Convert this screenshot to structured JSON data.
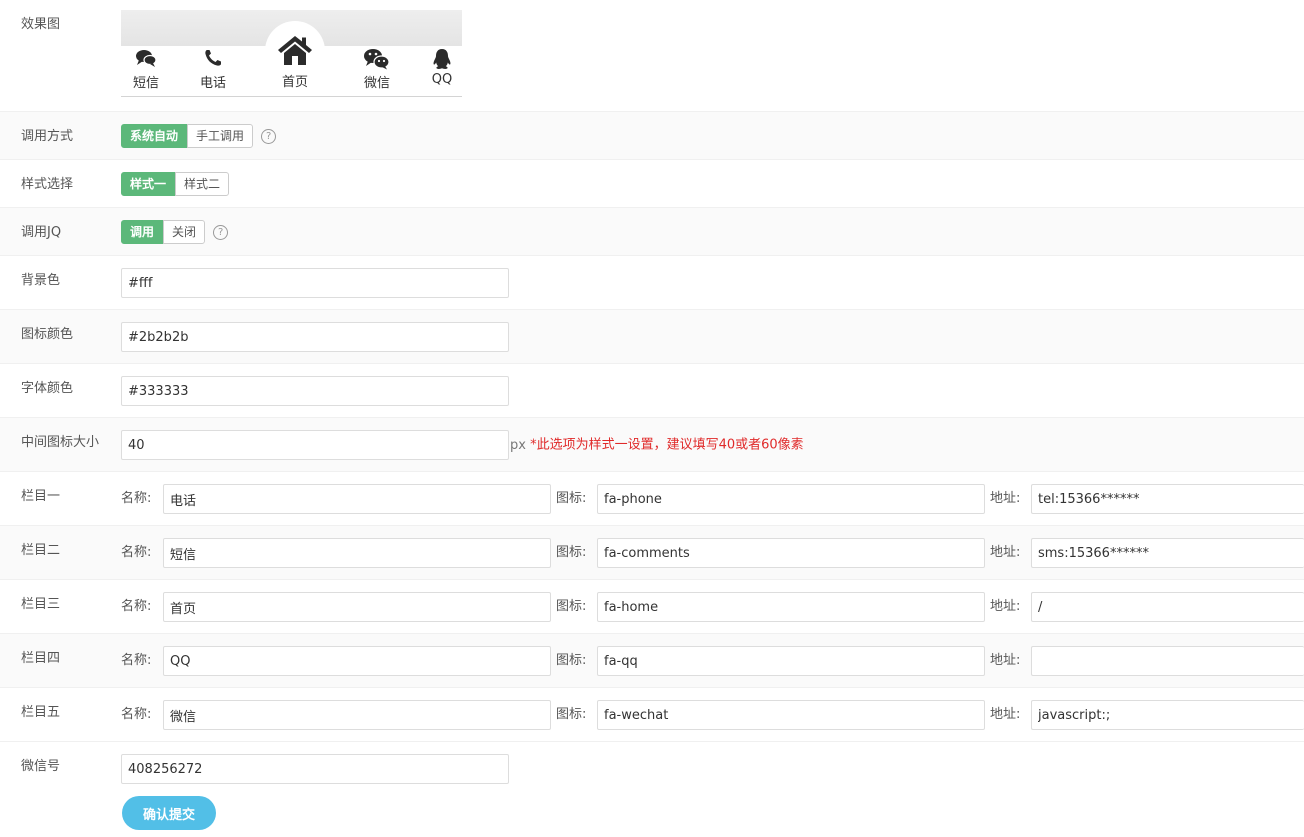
{
  "preview": {
    "label": "效果图",
    "items": [
      {
        "text": "短信",
        "icon": "comments-icon"
      },
      {
        "text": "电话",
        "icon": "phone-icon"
      },
      {
        "text": "首页",
        "icon": "home-icon"
      },
      {
        "text": "微信",
        "icon": "wechat-icon"
      },
      {
        "text": "QQ",
        "icon": "qq-icon"
      }
    ]
  },
  "call_mode": {
    "label": "调用方式",
    "options": [
      "系统自动",
      "手工调用"
    ],
    "selected": "系统自动"
  },
  "style": {
    "label": "样式选择",
    "options": [
      "样式一",
      "样式二"
    ],
    "selected": "样式一"
  },
  "jq": {
    "label": "调用JQ",
    "options": [
      "调用",
      "关闭"
    ],
    "selected": "调用"
  },
  "help_glyph": "?",
  "bg_color": {
    "label": "背景色",
    "value": "#fff"
  },
  "icon_color": {
    "label": "图标颜色",
    "value": "#2b2b2b"
  },
  "font_color": {
    "label": "字体颜色",
    "value": "#333333"
  },
  "center_icon": {
    "label": "中间图标大小",
    "value": "40",
    "unit": "px",
    "note": "*此选项为样式一设置，建议填写40或者60像素"
  },
  "field_labels": {
    "name": "名称:",
    "icon": "图标:",
    "url": "地址:"
  },
  "columns": [
    {
      "label": "栏目一",
      "name": "电话",
      "icon": "fa-phone",
      "url": "tel:15366******"
    },
    {
      "label": "栏目二",
      "name": "短信",
      "icon": "fa-comments",
      "url": "sms:15366******"
    },
    {
      "label": "栏目三",
      "name": "首页",
      "icon": "fa-home",
      "url": "/"
    },
    {
      "label": "栏目四",
      "name": "QQ",
      "icon": "fa-qq",
      "url": ""
    },
    {
      "label": "栏目五",
      "name": "微信",
      "icon": "fa-wechat",
      "url": "javascript:;"
    }
  ],
  "wechat": {
    "label": "微信号",
    "value": "408256272"
  },
  "submit_label": "确认提交",
  "colors": {
    "accent_green": "#5cb87a",
    "submit_blue": "#52bfe7",
    "warning_red": "#e02a2a"
  }
}
